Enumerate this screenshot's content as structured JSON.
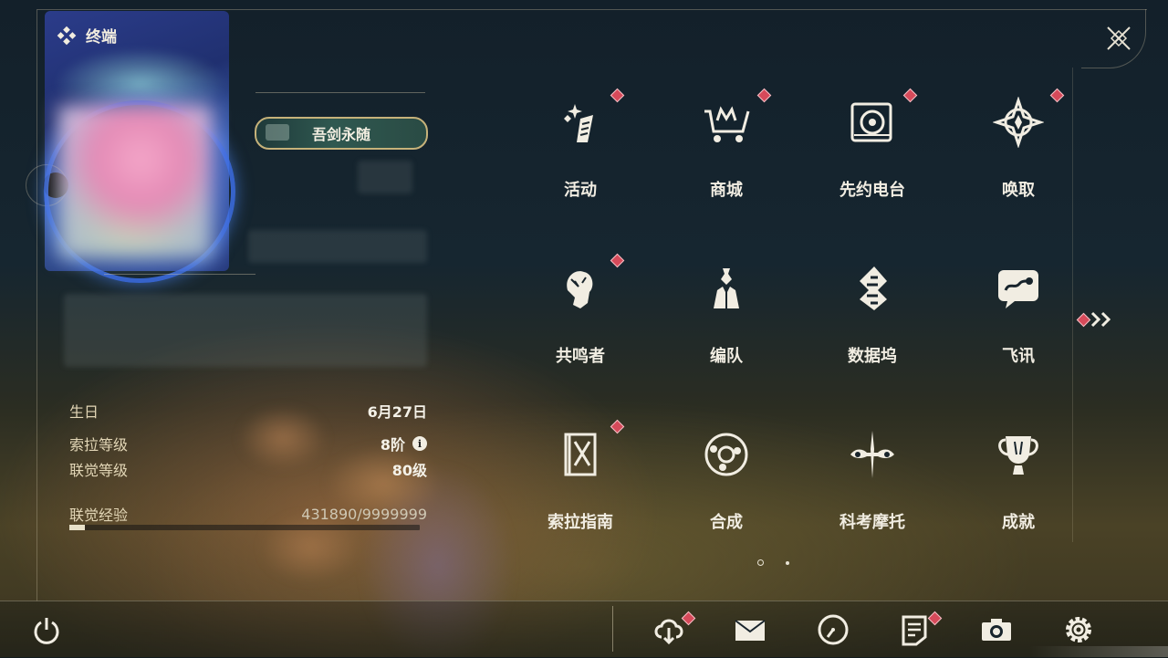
{
  "window": {
    "title": "终端"
  },
  "profile": {
    "title_badge": "吾剑永随",
    "info": [
      {
        "label": "生日",
        "value": "6月27日"
      },
      {
        "label": "索拉等级",
        "value": "8阶"
      },
      {
        "label": "联觉等级",
        "value": "80级"
      }
    ],
    "exp": {
      "label": "联觉经验",
      "value": "431890/9999999",
      "progress": 0.0432
    }
  },
  "menu": {
    "items": [
      {
        "label": "活动",
        "icon": "activity-icon",
        "badge": true
      },
      {
        "label": "商城",
        "icon": "shop-cart-icon",
        "badge": true
      },
      {
        "label": "先约电台",
        "icon": "radio-icon",
        "badge": true
      },
      {
        "label": "唤取",
        "icon": "summon-icon",
        "badge": true
      },
      {
        "label": "共鸣者",
        "icon": "resonator-icon",
        "badge": true
      },
      {
        "label": "编队",
        "icon": "team-icon",
        "badge": false
      },
      {
        "label": "数据坞",
        "icon": "databank-icon",
        "badge": false
      },
      {
        "label": "飞讯",
        "icon": "message-icon",
        "badge": false
      },
      {
        "label": "索拉指南",
        "icon": "guidebook-icon",
        "badge": true
      },
      {
        "label": "合成",
        "icon": "synthesis-icon",
        "badge": false
      },
      {
        "label": "科考摩托",
        "icon": "motorcycle-icon",
        "badge": false
      },
      {
        "label": "成就",
        "icon": "trophy-icon",
        "badge": false
      }
    ],
    "pagination": {
      "current": 1,
      "total": 2
    }
  },
  "bottom_bar": {
    "buttons": [
      {
        "name": "download",
        "icon": "cloud-download-icon",
        "badge": true
      },
      {
        "name": "mail",
        "icon": "mail-icon",
        "badge": false
      },
      {
        "name": "clock",
        "icon": "clock-icon",
        "badge": false
      },
      {
        "name": "notice",
        "icon": "notice-icon",
        "badge": true
      },
      {
        "name": "camera",
        "icon": "camera-icon",
        "badge": false
      },
      {
        "name": "settings",
        "icon": "gear-icon",
        "badge": false
      }
    ]
  },
  "colors": {
    "badge": "#d64a5a",
    "text": "#f1ede2",
    "accent_gold": "#c6b27a"
  }
}
